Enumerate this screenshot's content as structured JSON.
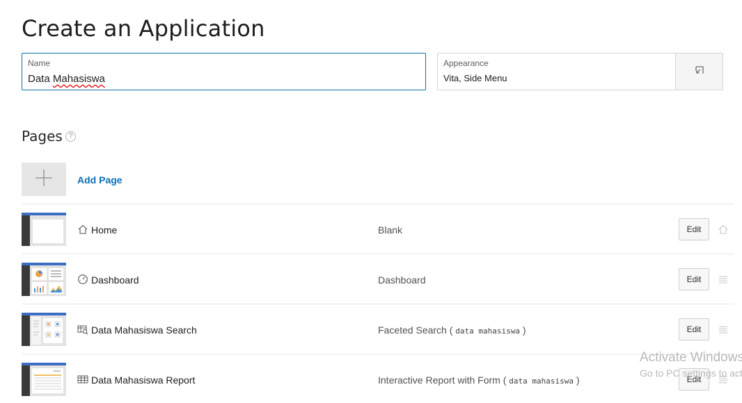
{
  "header": {
    "title": "Create an Application"
  },
  "name_field": {
    "label": "Name",
    "value_plain": "Data ",
    "value_underlined": "Mahasiswa"
  },
  "appearance_field": {
    "label": "Appearance",
    "value": "Vita, Side Menu",
    "button_icon": "open-dialog-icon"
  },
  "pages": {
    "heading": "Pages",
    "help_glyph": "?",
    "add_page_label": "Add Page",
    "rows": [
      {
        "name": "Home",
        "type": "Blank",
        "type_arg": "",
        "edit_label": "Edit",
        "icon": "home-icon",
        "end_icon": "home-icon"
      },
      {
        "name": "Dashboard",
        "type": "Dashboard",
        "type_arg": "",
        "edit_label": "Edit",
        "icon": "gauge-icon",
        "end_icon": "drag-handle-icon"
      },
      {
        "name": "Data Mahasiswa Search",
        "type": "Faceted Search ( ",
        "type_arg": "data mahasiswa",
        "type_close": " )",
        "edit_label": "Edit",
        "icon": "search-report-icon",
        "end_icon": "drag-handle-icon"
      },
      {
        "name": "Data Mahasiswa Report",
        "type": "Interactive Report with Form ( ",
        "type_arg": "data mahasiswa",
        "type_close": " )",
        "edit_label": "Edit",
        "icon": "table-icon",
        "end_icon": "drag-handle-icon"
      }
    ]
  },
  "watermark": {
    "line1": "Activate Windows",
    "line2": "Go to PC settings to activate"
  },
  "colors": {
    "accent": "#0a6fb5",
    "focus_border": "#0b6fa4",
    "thumb_bar": "#3b6fc2",
    "thumb_side": "#3a3a3a"
  }
}
